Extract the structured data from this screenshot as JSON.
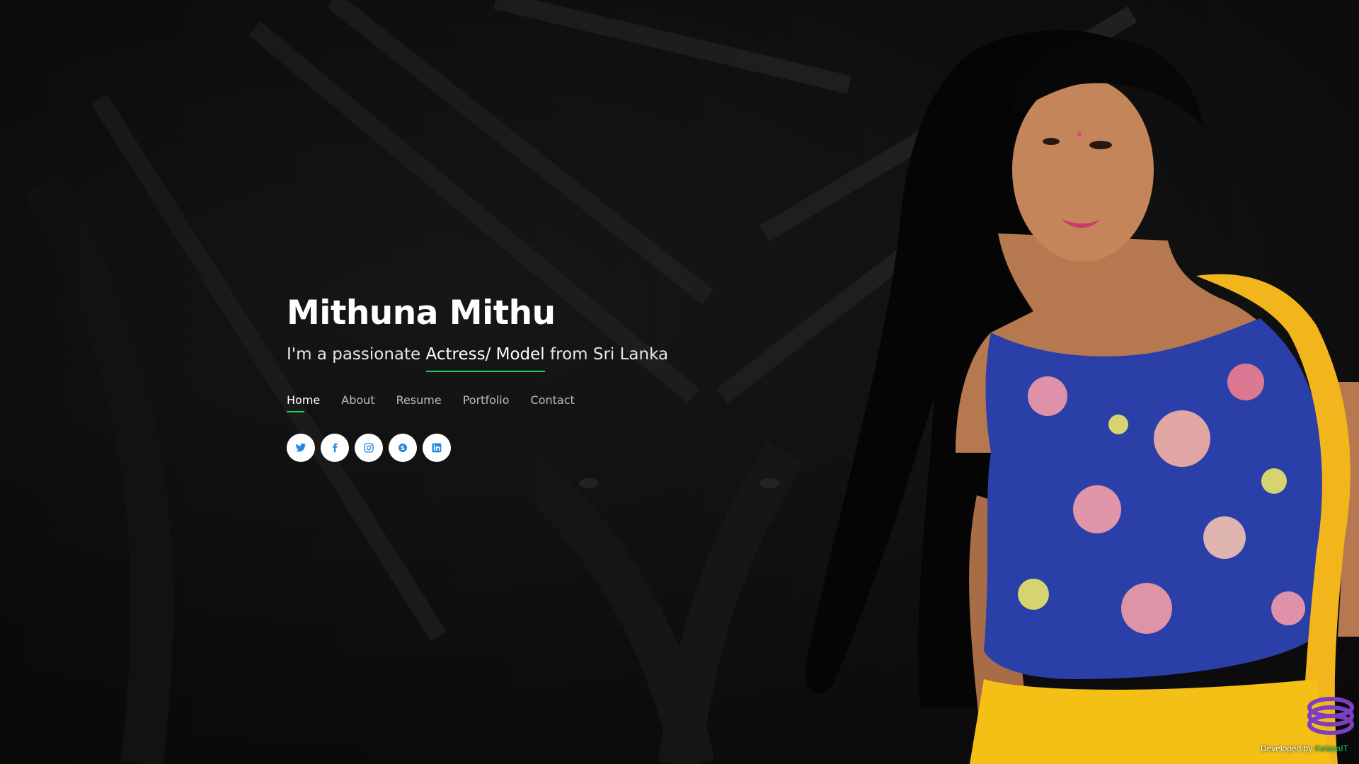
{
  "hero": {
    "name": "Mithuna Mithu",
    "tagline_prefix": "I'm a passionate",
    "tagline_typed": "Actress/ Model",
    "tagline_suffix": "from Sri Lanka"
  },
  "nav": {
    "items": [
      {
        "label": "Home",
        "active": true
      },
      {
        "label": "About",
        "active": false
      },
      {
        "label": "Resume",
        "active": false
      },
      {
        "label": "Portfolio",
        "active": false
      },
      {
        "label": "Contact",
        "active": false
      }
    ]
  },
  "social": {
    "icons": [
      "twitter-icon",
      "facebook-icon",
      "instagram-icon",
      "skype-icon",
      "linkedin-icon"
    ]
  },
  "credits": {
    "prefix": "Developed by",
    "developer": "KelaxaIT"
  },
  "colors": {
    "accent": "#18d26e",
    "background": "#0c0c0c",
    "icon_blue": "#1e88e5",
    "text": "#ffffff"
  }
}
